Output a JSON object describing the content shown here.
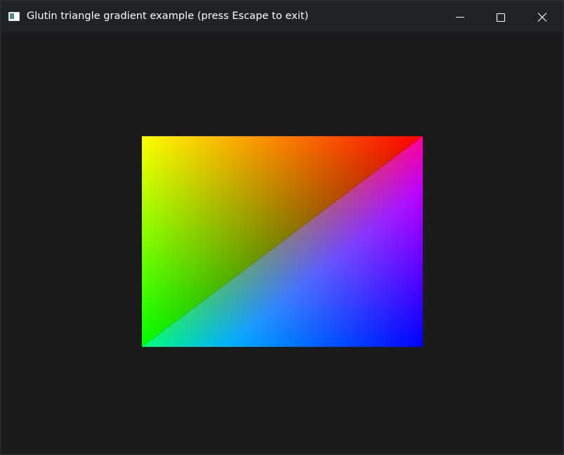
{
  "window": {
    "title": "Glutin triangle gradient example (press Escape to exit)",
    "icon": "window-app-icon"
  },
  "caption_buttons": {
    "minimize": "minimize-icon",
    "maximize": "maximize-icon",
    "close": "close-icon"
  },
  "canvas": {
    "background": "#1b1b1b",
    "vertex_colors": {
      "top_right": "#ff0000",
      "bottom_left": "#00ff00",
      "bottom_right": "#0000ff",
      "top_left_blend": "#808000"
    }
  }
}
